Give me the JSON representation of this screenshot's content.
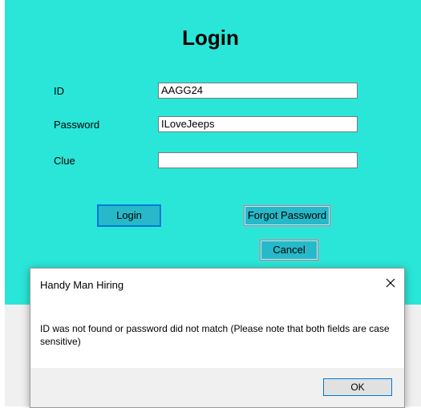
{
  "login_form": {
    "title": "Login",
    "id_label": "ID",
    "id_value": "AAGG24",
    "password_label": "Password",
    "password_value": "ILoveJeeps",
    "clue_label": "Clue",
    "clue_value": "",
    "login_button": "Login",
    "forgot_button": "Forgot Password",
    "cancel_button": "Cancel"
  },
  "dialog": {
    "title": "Handy Man Hiring",
    "message": "ID was not found or password did not match (Please note that both fields are case sensitive)",
    "ok_button": "OK",
    "close_icon": "close-icon"
  },
  "colors": {
    "form_background": "#2ae6d8",
    "button_background": "#26b9c9",
    "focus_border": "#0078d7"
  }
}
